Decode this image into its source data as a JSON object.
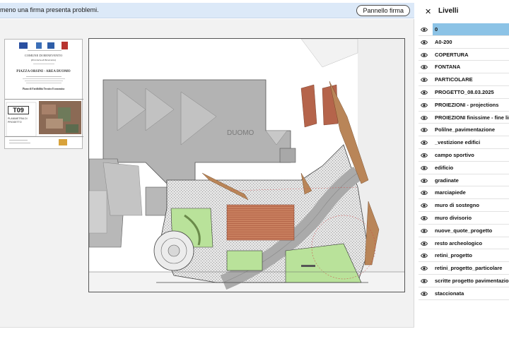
{
  "notice": {
    "text": "meno una firma presenta problemi.",
    "panel_button_label": "Pannello firma"
  },
  "titleblock": {
    "municipality": "COMUNE DI BENEVENTO",
    "province": "(Provincia di Benevento)",
    "project_title": "PIAZZA ORSINI - AREA DUOMO",
    "plan_label": "Piano di Fattibilità Tecnico Economica",
    "sheet_code": "T09",
    "sheet_title": "PLANIMETRIA DI PROGETTO"
  },
  "drawing": {
    "building_label": "DUOMO"
  },
  "layers_panel": {
    "title": "Livelli",
    "close_icon": "close-icon",
    "selected_color": "#8cc3e6",
    "items": [
      {
        "label": "0",
        "selected": true
      },
      {
        "label": "A0-200"
      },
      {
        "label": "COPERTURA"
      },
      {
        "label": "FONTANA"
      },
      {
        "label": "PARTICOLARE"
      },
      {
        "label": "PROGETTO_08.03.2025"
      },
      {
        "label": "PROIEZIONI - projections"
      },
      {
        "label": "PROIEZIONI finissime - fine lines"
      },
      {
        "label": "Polilne_pavimentazione"
      },
      {
        "label": "_vestizione edifici"
      },
      {
        "label": "campo sportivo"
      },
      {
        "label": "edificio"
      },
      {
        "label": "gradinate"
      },
      {
        "label": "marciapiede"
      },
      {
        "label": "muro di sostegno"
      },
      {
        "label": "muro divisorio"
      },
      {
        "label": "nuove_quote_progetto"
      },
      {
        "label": "resto archeologico"
      },
      {
        "label": "retini_progetto"
      },
      {
        "label": "retini_progetto_particolare"
      },
      {
        "label": "scritte progetto pavimentazioni"
      },
      {
        "label": "staccionata"
      }
    ]
  }
}
